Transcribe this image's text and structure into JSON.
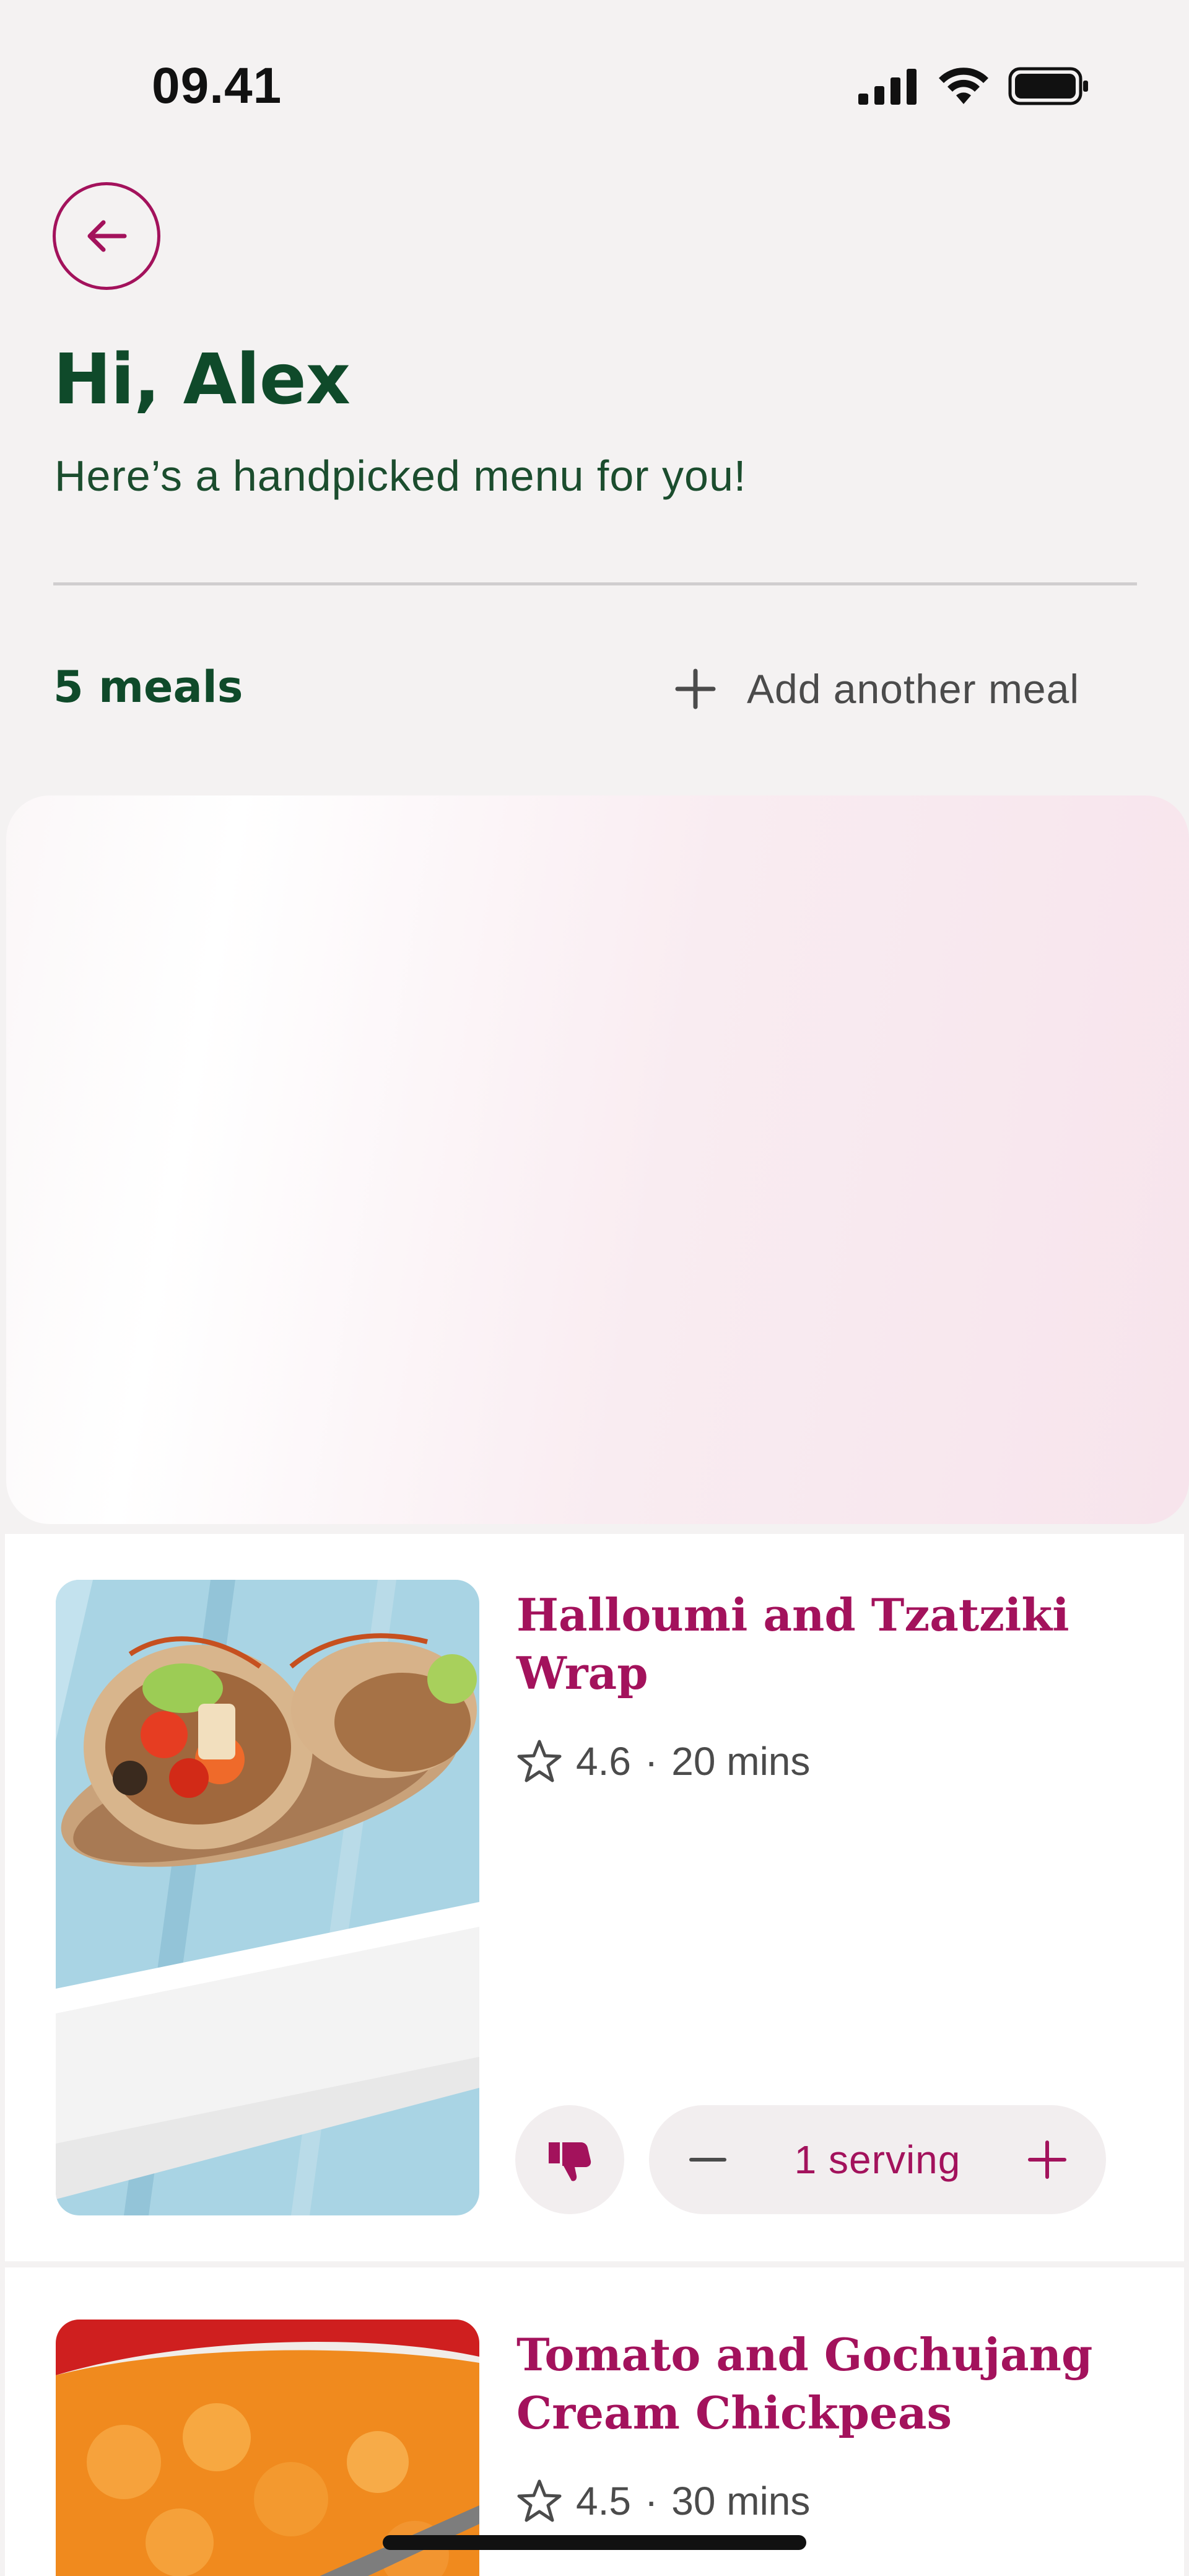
{
  "status_bar": {
    "time": "09.41"
  },
  "header": {
    "greeting": "Hi, Alex",
    "subtitle": "Here’s a handpicked menu for you!"
  },
  "summary": {
    "meal_count": "5 meals",
    "add_meal_label": "Add another meal"
  },
  "meals": [
    {
      "title": "Halloumi and Tzatziki Wrap",
      "rating": "4.6",
      "duration": "20 mins",
      "serving": "1 serving"
    },
    {
      "title": "Tomato and Gochujang Cream Chickpeas",
      "rating": "4.5",
      "duration": "30 mins"
    }
  ],
  "colors": {
    "brand": "#a3125c",
    "heading": "#0f4a2a",
    "background": "#f4f2f2"
  },
  "icons": [
    "signal-icon",
    "wifi-icon",
    "battery-icon",
    "back-arrow-icon",
    "plus-icon",
    "star-icon",
    "thumbs-down-icon",
    "minus-icon"
  ]
}
